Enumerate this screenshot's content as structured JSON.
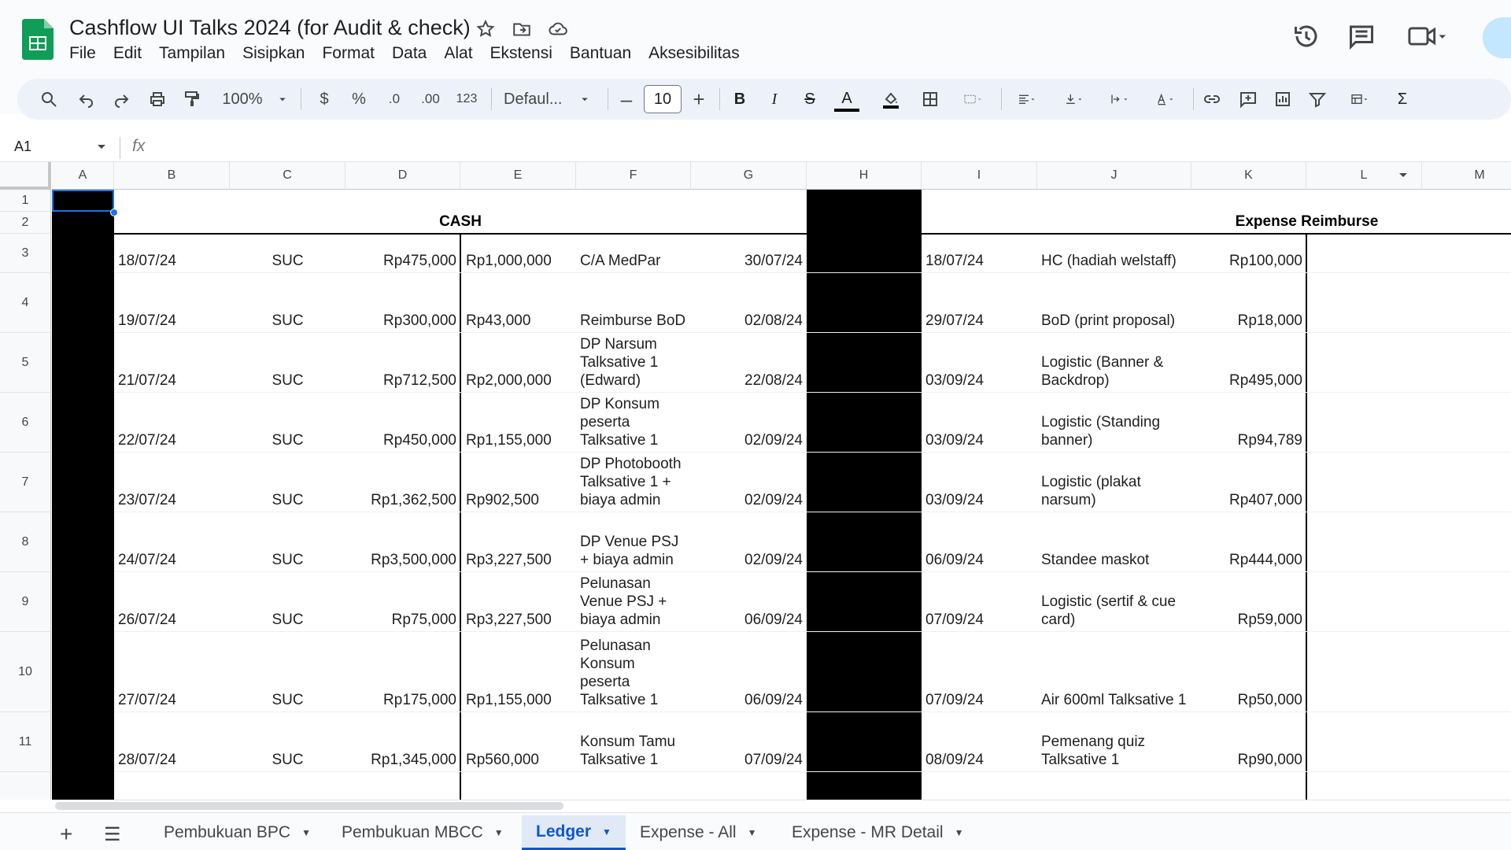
{
  "app": {
    "title": "Cashflow UI Talks 2024 (for Audit & check)",
    "brand_color": "#0f9d58"
  },
  "menu": [
    "File",
    "Edit",
    "Tampilan",
    "Sisipkan",
    "Format",
    "Data",
    "Alat",
    "Ekstensi",
    "Bantuan",
    "Aksesibilitas"
  ],
  "toolbar": {
    "zoom": "100%",
    "currency": "$",
    "percent": "%",
    "dec_decrease": ".0",
    "dec_increase": ".00",
    "number_format": "123",
    "font": "Defaul...",
    "minus": "–",
    "font_size": "10",
    "plus": "+",
    "bold": "B",
    "italic": "I",
    "strike": "S",
    "text_color": "A",
    "sum": "Σ"
  },
  "formula_bar": {
    "name_box": "A1",
    "fx": "fx",
    "value": ""
  },
  "columns": [
    "A",
    "B",
    "C",
    "D",
    "E",
    "F",
    "G",
    "H",
    "I",
    "J",
    "K",
    "L",
    "M"
  ],
  "rows": [
    "1",
    "2",
    "3",
    "4",
    "5",
    "6",
    "7",
    "8",
    "9",
    "10",
    "11"
  ],
  "sections": {
    "cash": "CASH",
    "expense": "Expense Reimburse"
  },
  "table": [
    {
      "b": "18/07/24",
      "c": "SUC",
      "d": "Rp475,000",
      "e": "Rp1,000,000",
      "f": "C/A MedPar",
      "g": "30/07/24",
      "i": "18/07/24",
      "j": "HC (hadiah welstaff)",
      "k": "Rp100,000"
    },
    {
      "b": "19/07/24",
      "c": "SUC",
      "d": "Rp300,000",
      "e": "Rp43,000",
      "f": "Reimburse BoD",
      "g": "02/08/24",
      "i": "29/07/24",
      "j": "BoD (print proposal)",
      "k": "Rp18,000"
    },
    {
      "b": "21/07/24",
      "c": "SUC",
      "d": "Rp712,500",
      "e": "Rp2,000,000",
      "f": "DP Narsum Talksative 1 (Edward)",
      "g": "22/08/24",
      "i": "03/09/24",
      "j": "Logistic (Banner & Backdrop)",
      "k": "Rp495,000"
    },
    {
      "b": "22/07/24",
      "c": "SUC",
      "d": "Rp450,000",
      "e": "Rp1,155,000",
      "f": "DP Konsum peserta Talksative 1",
      "g": "02/09/24",
      "i": "03/09/24",
      "j": "Logistic (Standing banner)",
      "k": "Rp94,789"
    },
    {
      "b": "23/07/24",
      "c": "SUC",
      "d": "Rp1,362,500",
      "e": "Rp902,500",
      "f": "DP Photobooth Talksative 1 + biaya admin",
      "g": "02/09/24",
      "i": "03/09/24",
      "j": "Logistic (plakat narsum)",
      "k": "Rp407,000"
    },
    {
      "b": "24/07/24",
      "c": "SUC",
      "d": "Rp3,500,000",
      "e": "Rp3,227,500",
      "f": "DP Venue PSJ + biaya admin",
      "g": "02/09/24",
      "i": "06/09/24",
      "j": "Standee maskot",
      "k": "Rp444,000"
    },
    {
      "b": "26/07/24",
      "c": "SUC",
      "d": "Rp75,000",
      "e": "Rp3,227,500",
      "f": "Pelunasan Venue PSJ + biaya admin",
      "g": "06/09/24",
      "i": "07/09/24",
      "j": "Logistic (sertif & cue card)",
      "k": "Rp59,000"
    },
    {
      "b": "27/07/24",
      "c": "SUC",
      "d": "Rp175,000",
      "e": "Rp1,155,000",
      "f": "Pelunasan Konsum peserta Talksative 1",
      "g": "06/09/24",
      "i": "07/09/24",
      "j": "Air 600ml Talksative 1",
      "k": "Rp50,000"
    },
    {
      "b": "28/07/24",
      "c": "SUC",
      "d": "Rp1,345,000",
      "e": "Rp560,000",
      "f": "Konsum Tamu Talksative 1",
      "g": "07/09/24",
      "i": "08/09/24",
      "j": "Pemenang quiz Talksative 1",
      "k": "Rp90,000"
    }
  ],
  "sheets": [
    {
      "name": "Pembukuan BPC",
      "active": false
    },
    {
      "name": "Pembukuan MBCC",
      "active": false
    },
    {
      "name": "Ledger",
      "active": true
    },
    {
      "name": "Expense - All",
      "active": false
    },
    {
      "name": "Expense - MR Detail",
      "active": false
    }
  ],
  "sheet_controls": {
    "add": "+",
    "list": "☰"
  }
}
